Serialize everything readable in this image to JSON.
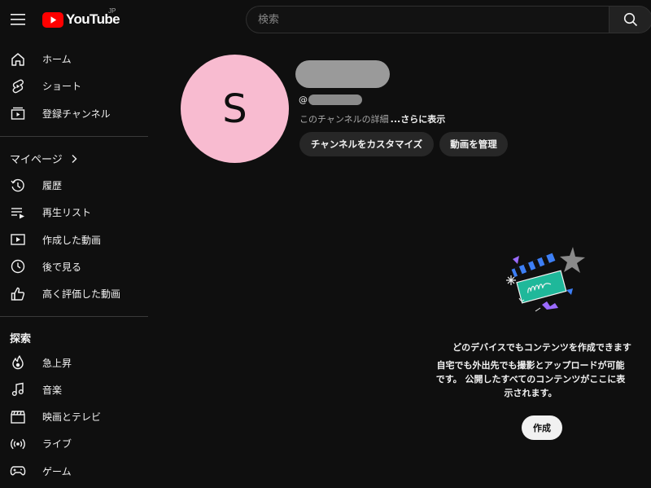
{
  "header": {
    "logo_text": "YouTube",
    "region": "JP",
    "search_placeholder": "検索"
  },
  "sidebar": {
    "main": [
      {
        "label": "ホーム",
        "icon": "home-icon"
      },
      {
        "label": "ショート",
        "icon": "shorts-icon"
      },
      {
        "label": "登録チャンネル",
        "icon": "subscriptions-icon"
      }
    ],
    "you_section": "マイページ",
    "you_items": [
      {
        "label": "履歴",
        "icon": "history-icon"
      },
      {
        "label": "再生リスト",
        "icon": "playlists-icon"
      },
      {
        "label": "作成した動画",
        "icon": "your-videos-icon"
      },
      {
        "label": "後で見る",
        "icon": "watch-later-icon"
      },
      {
        "label": "高く評価した動画",
        "icon": "liked-videos-icon"
      }
    ],
    "explore_title": "探索",
    "explore_items": [
      {
        "label": "急上昇",
        "icon": "trending-icon"
      },
      {
        "label": "音楽",
        "icon": "music-icon"
      },
      {
        "label": "映画とテレビ",
        "icon": "movies-icon"
      },
      {
        "label": "ライブ",
        "icon": "live-icon"
      },
      {
        "label": "ゲーム",
        "icon": "gaming-icon"
      }
    ]
  },
  "channel": {
    "avatar_letter": "S",
    "avatar_color": "#f8bbd0",
    "handle_prefix": "@",
    "about_text": "このチャンネルの詳細",
    "about_more": "...さらに表示",
    "customize_button": "チャンネルをカスタマイズ",
    "manage_button": "動画を管理"
  },
  "empty_state": {
    "title": "どのデバイスでもコンテンツを作成できます",
    "description": "自宅でも外出先でも撮影とアップロードが可能です。 公開したすべてのコンテンツがここに表示されます。",
    "create_button": "作成"
  },
  "colors": {
    "brand_red": "#ff0000",
    "background": "#0f0f0f"
  }
}
